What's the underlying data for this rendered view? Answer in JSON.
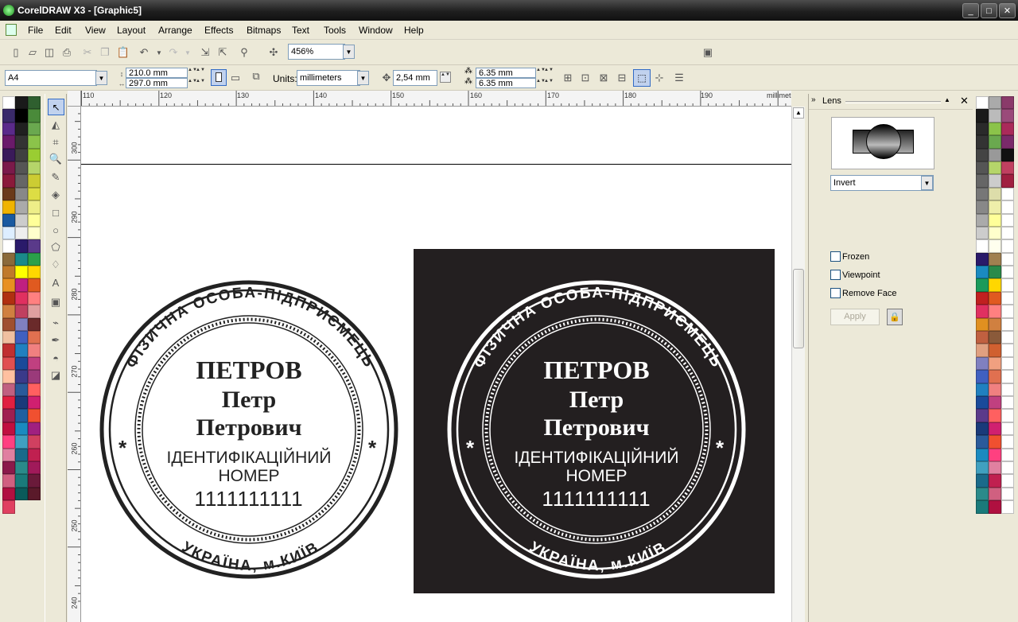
{
  "window": {
    "title": "CorelDRAW X3 - [Graphic5]",
    "min": "_",
    "max": "□",
    "close": "✕"
  },
  "menu": [
    "File",
    "Edit",
    "View",
    "Layout",
    "Arrange",
    "Effects",
    "Bitmaps",
    "Text",
    "Tools",
    "Window",
    "Help"
  ],
  "toolbar": {
    "zoom": "456%"
  },
  "propbar": {
    "paper": "A4",
    "width": "210.0 mm",
    "height": "297.0 mm",
    "units_label": "Units:",
    "units": "millimeters",
    "nudge": "2,54 mm",
    "dup_x": "6.35 mm",
    "dup_y": "6.35 mm"
  },
  "ruler": {
    "h_labels": [
      "110",
      "120",
      "130",
      "140",
      "150",
      "160",
      "170",
      "180",
      "190"
    ],
    "h_units": "millimeters",
    "v_labels": [
      "300",
      "290",
      "280",
      "270",
      "260",
      "250",
      "240"
    ]
  },
  "stamp_left": {
    "top_arc": "ФІЗИЧНА   ОСОБА-ПІДПРИЄМЕЦЬ",
    "bottom_arc": "УКРАЇНА,   м.КИЇВ",
    "line1": "ПЕТРОВ",
    "line2": "Петр",
    "line3": "Петрович",
    "line4": "ІДЕНТИФІКАЦІЙНИЙ",
    "line5": "НОМЕР",
    "line6": "1111111111",
    "star": "*"
  },
  "stamp_right": {
    "top_arc": "ФІЗИЧНА   ОСОБА-ПІДПРИЄМЕЦЬ",
    "bottom_arc": "УКРАЇНА,   м.КИЇВ",
    "line1": "ПЕТРОВ",
    "line2": "Петр",
    "line3": "Петрович",
    "line4": "ІДЕНТИФІКАЦІЙНИЙ",
    "line5": "НОМЕР",
    "line6": "1111111111",
    "star": "*"
  },
  "docker": {
    "title": "Lens",
    "lens_type": "Invert",
    "frozen": "Frozen",
    "viewpoint": "Viewpoint",
    "remove_face": "Remove Face",
    "apply": "Apply"
  },
  "colors": {
    "accent": "#316ac5",
    "stamp_bg": "#231f20"
  },
  "palette_left": [
    "#ffffff",
    "#1a1a1a",
    "#2f5f2f",
    "#3a2a6a",
    "#000000",
    "#4a8a3a",
    "#5a2a8a",
    "#202020",
    "#6aa84f",
    "#6a1a6a",
    "#333333",
    "#8bc34a",
    "#3a1a5a",
    "#404040",
    "#9acd32",
    "#7a1a4a",
    "#555555",
    "#b5d56a",
    "#8a1a3a",
    "#666666",
    "#cccc33",
    "#6a3a1a",
    "#888888",
    "#dddd44",
    "#f0b400",
    "#aaaaaa",
    "#eeee88",
    "#1a5aa0",
    "#cccccc",
    "#ffff99",
    "#ddeeff",
    "#eeeeee",
    "#ffffcc",
    "#ffffff",
    "#2a1a6a",
    "#5a3a8a",
    "#8a6a3a",
    "#1a8a8a",
    "#2aa04a",
    "#c07a2a",
    "#ffff00",
    "#ffd700",
    "#e89020",
    "#c02080",
    "#e05a20",
    "#b03010",
    "#e03060",
    "#ff8080",
    "#d08040",
    "#c04060",
    "#e0a0a0",
    "#a05030",
    "#8080c0",
    "#6a2a2a",
    "#f0c0a0",
    "#4060c0",
    "#e07050",
    "#c03030",
    "#2080c0",
    "#f08080",
    "#e05050",
    "#1a4a9a",
    "#c04080",
    "#ffc0a0",
    "#3a3a8a",
    "#9a3a7a",
    "#c06080",
    "#2a5a9a",
    "#ff6060",
    "#e02040",
    "#1a3a7a",
    "#d02070",
    "#a02050",
    "#2060a0",
    "#f05030",
    "#c01040",
    "#1a8ac0",
    "#a02080",
    "#ff4080",
    "#40a0c0",
    "#d04060",
    "#e080a0",
    "#1a6a8a",
    "#c02050",
    "#8a1a4a",
    "#2a8a8a",
    "#a01a5a",
    "#d06080",
    "#1a7a7a",
    "#6a1a3a",
    "#b01040",
    "#0a5a5a",
    "#5a1a2a",
    "#e04060"
  ],
  "palette_right": [
    "#ffffff",
    "#aaaaaa",
    "#8a3a6a",
    "#1a1a1a",
    "#bbbbbb",
    "#9a4a7a",
    "#2a2a2a",
    "#8bc34a",
    "#aa2a5a",
    "#333333",
    "#6aa84f",
    "#7a2a6a",
    "#444444",
    "#999999",
    "#111111",
    "#555555",
    "#b5d56a",
    "#c04060",
    "#666666",
    "#cccccc",
    "#a02040",
    "#777777",
    "#ddddaa",
    "#fff",
    "#888888",
    "#eeeeaa",
    "#fff",
    "#aaaaaa",
    "#ffff99",
    "#fff",
    "#cccccc",
    "#ffffcc",
    "#fff",
    "#ffffff",
    "#ffffee",
    "#fff",
    "#2a1a6a",
    "#a08050",
    "#fff",
    "#1a8ac0",
    "#2a8a4a",
    "#fff",
    "#1a9a5a",
    "#ffd700",
    "#fff",
    "#c02020",
    "#e05a20",
    "#fff",
    "#e03060",
    "#ff8080",
    "#fff",
    "#e09020",
    "#d08040",
    "#fff",
    "#c06040",
    "#8a5a3a",
    "#fff",
    "#e0a080",
    "#d06030",
    "#fff",
    "#8080c0",
    "#f0a080",
    "#fff",
    "#4060c0",
    "#e07050",
    "#fff",
    "#2080c0",
    "#f08080",
    "#fff",
    "#1a4a9a",
    "#c04080",
    "#fff",
    "#5a3a8a",
    "#ff6060",
    "#fff",
    "#1a3a7a",
    "#d02070",
    "#fff",
    "#2a5a9a",
    "#f05030",
    "#fff",
    "#1a8ac0",
    "#ff4080",
    "#fff",
    "#40a0c0",
    "#e080a0",
    "#fff",
    "#1a6a8a",
    "#c02050",
    "#fff",
    "#2a8a8a",
    "#d06080",
    "#fff",
    "#1a7a7a",
    "#b01040",
    "#fff"
  ]
}
